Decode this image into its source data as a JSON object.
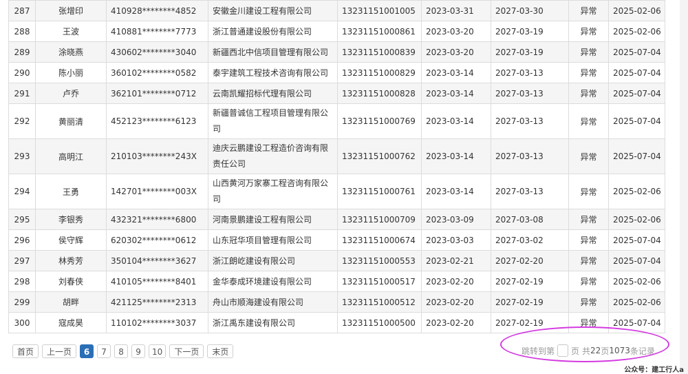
{
  "rows": [
    {
      "no": "287",
      "name": "张增印",
      "id": "410928********4852",
      "company": "安徽金川建设工程有限公司",
      "cert": "13231151001005",
      "issue": "2023-03-31",
      "expire": "2027-03-30",
      "status": "异常",
      "date": "2025-02-06"
    },
    {
      "no": "288",
      "name": "王波",
      "id": "410881********7773",
      "company": "浙江普通建设股份有限公司",
      "cert": "13231151000861",
      "issue": "2023-03-20",
      "expire": "2027-03-19",
      "status": "异常",
      "date": "2025-02-06"
    },
    {
      "no": "289",
      "name": "涂晓燕",
      "id": "430602********3040",
      "company": "新疆西北中信项目管理有限公司",
      "cert": "13231151000839",
      "issue": "2023-03-20",
      "expire": "2027-03-19",
      "status": "异常",
      "date": "2025-07-04"
    },
    {
      "no": "290",
      "name": "陈小丽",
      "id": "360102********0582",
      "company": "泰宇建筑工程技术咨询有限公司",
      "cert": "13231151000829",
      "issue": "2023-03-14",
      "expire": "2027-03-13",
      "status": "异常",
      "date": "2025-07-04"
    },
    {
      "no": "291",
      "name": "卢乔",
      "id": "362101********0712",
      "company": "云南凯耀招标代理有限公司",
      "cert": "13231151000828",
      "issue": "2023-03-14",
      "expire": "2027-03-13",
      "status": "异常",
      "date": "2025-07-04"
    },
    {
      "no": "292",
      "name": "黄丽清",
      "id": "452123********6123",
      "company": "新疆普诚信工程项目管理有限公司",
      "cert": "13231151000769",
      "issue": "2023-03-14",
      "expire": "2027-03-13",
      "status": "异常",
      "date": "2025-07-04"
    },
    {
      "no": "293",
      "name": "高明江",
      "id": "210103********243X",
      "company": "迪庆云鹏建设工程造价咨询有限责任公司",
      "cert": "13231151000762",
      "issue": "2023-03-14",
      "expire": "2027-03-13",
      "status": "异常",
      "date": "2025-07-04"
    },
    {
      "no": "294",
      "name": "王勇",
      "id": "142701********003X",
      "company": "山西黄河万家寨工程咨询有限公司",
      "cert": "13231151000761",
      "issue": "2023-03-14",
      "expire": "2027-03-13",
      "status": "异常",
      "date": "2025-02-06"
    },
    {
      "no": "295",
      "name": "李银秀",
      "id": "432321********6800",
      "company": "河南景鹏建设工程有限公司",
      "cert": "13231151000709",
      "issue": "2023-03-09",
      "expire": "2027-03-08",
      "status": "异常",
      "date": "2025-02-06"
    },
    {
      "no": "296",
      "name": "侯守辉",
      "id": "620302********0612",
      "company": "山东冠华项目管理有限公司",
      "cert": "13231151000674",
      "issue": "2023-03-03",
      "expire": "2027-03-02",
      "status": "异常",
      "date": "2025-07-04"
    },
    {
      "no": "297",
      "name": "林秀芳",
      "id": "350104********3627",
      "company": "浙江朗屹建设有限公司",
      "cert": "13231151000553",
      "issue": "2023-02-21",
      "expire": "2027-02-20",
      "status": "异常",
      "date": "2025-07-04"
    },
    {
      "no": "298",
      "name": "刘春侠",
      "id": "410105********8401",
      "company": "金华泰成环境建设有限公司",
      "cert": "13231151000517",
      "issue": "2023-02-20",
      "expire": "2027-02-19",
      "status": "异常",
      "date": "2025-02-06"
    },
    {
      "no": "299",
      "name": "胡畔",
      "id": "421125********2313",
      "company": "舟山市顺海建设有限公司",
      "cert": "13231151000512",
      "issue": "2023-02-20",
      "expire": "2027-02-19",
      "status": "异常",
      "date": "2025-02-06"
    },
    {
      "no": "300",
      "name": "寇成昊",
      "id": "110102********3037",
      "company": "浙江禹东建设有限公司",
      "cert": "13231151000500",
      "issue": "2023-02-20",
      "expire": "2027-02-19",
      "status": "异常",
      "date": "2025-07-04"
    }
  ],
  "pager": {
    "first": "首页",
    "prev": "上一页",
    "pages": [
      "6",
      "7",
      "8",
      "9",
      "10"
    ],
    "next": "下一页",
    "last": "末页",
    "jump_prefix": "跳转到第",
    "jump_suffix": "页",
    "total_label": "共",
    "total_pages": "22",
    "pages_unit": "页",
    "total_records": "1073",
    "records_unit": "条记录"
  },
  "footer": {
    "note": "公众号：建工行人a"
  },
  "colors": {
    "active_page": "#2a6fb6",
    "annotation_oval": "#d33be0"
  }
}
